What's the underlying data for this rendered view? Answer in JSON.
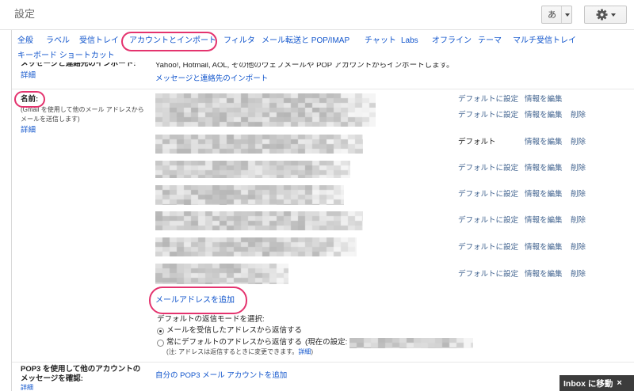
{
  "header": {
    "title": "設定",
    "input_tool_label": "あ"
  },
  "tabs": [
    {
      "label": "全般"
    },
    {
      "label": "ラベル"
    },
    {
      "label": "受信トレイ"
    },
    {
      "label": "アカウントとインポート",
      "active": true
    },
    {
      "label": "フィルタ"
    },
    {
      "label": "メール転送と POP/IMAP"
    },
    {
      "label": "チャット"
    },
    {
      "label": "Labs"
    },
    {
      "label": "オフライン"
    },
    {
      "label": "テーマ"
    },
    {
      "label": "マルチ受信トレイ"
    },
    {
      "label": "キーボード ショートカット"
    }
  ],
  "import_section": {
    "label": "メッセージと連絡先のインポート:",
    "detail_link": "詳細",
    "description": "Yahoo!, Hotmail, AOL, その他のウェブメールや POP アカウントからインポートします。",
    "action_link": "メッセージと連絡先のインポート"
  },
  "send_as_section": {
    "label": "名前:",
    "help_line1": "(Gmail を使用して他のメール アドレスから",
    "help_line2": "メールを送信します)",
    "detail_link": "詳細",
    "addresses": [
      {
        "default_label": "デフォルトに設定",
        "edit_label": "情報を編集"
      },
      {
        "default_label": "デフォルトに設定",
        "edit_label": "情報を編集",
        "delete_label": "削除"
      },
      {
        "default_label": "デフォルト",
        "is_default": true,
        "edit_label": "情報を編集",
        "delete_label": "削除"
      },
      {
        "default_label": "デフォルトに設定",
        "edit_label": "情報を編集",
        "delete_label": "削除"
      },
      {
        "default_label": "デフォルトに設定",
        "edit_label": "情報を編集",
        "delete_label": "削除"
      },
      {
        "default_label": "デフォルトに設定",
        "edit_label": "情報を編集",
        "delete_label": "削除"
      },
      {
        "default_label": "デフォルトに設定",
        "edit_label": "情報を編集",
        "delete_label": "削除"
      },
      {
        "default_label": "デフォルトに設定",
        "edit_label": "情報を編集",
        "delete_label": "削除"
      }
    ],
    "add_address_link": "メールアドレスを追加",
    "reply_mode_label": "デフォルトの返信モードを選択:",
    "reply_options": [
      {
        "label": "メールを受信したアドレスから返信する",
        "checked": true
      },
      {
        "label": "常にデフォルトのアドレスから返信する",
        "suffix": "(現在の設定:",
        "checked": false
      }
    ],
    "note_prefix": "(注: アドレスは返信するときに変更できます。",
    "note_link": "詳細",
    "note_suffix": ")"
  },
  "pop3_section": {
    "label_line1": "POP3 を使用して他のアカウントの",
    "label_line2": "メッセージを確認:",
    "detail_link": "詳細",
    "action_link": "自分の POP3 メール アカウントを追加"
  },
  "toast": {
    "label": "Inbox に移動",
    "close": "×"
  },
  "colors": {
    "link": "#1155cc",
    "action_link": "#41638f",
    "annotation": "#e4336e",
    "toast_background": "#3c3c3c",
    "text": "#222222"
  }
}
